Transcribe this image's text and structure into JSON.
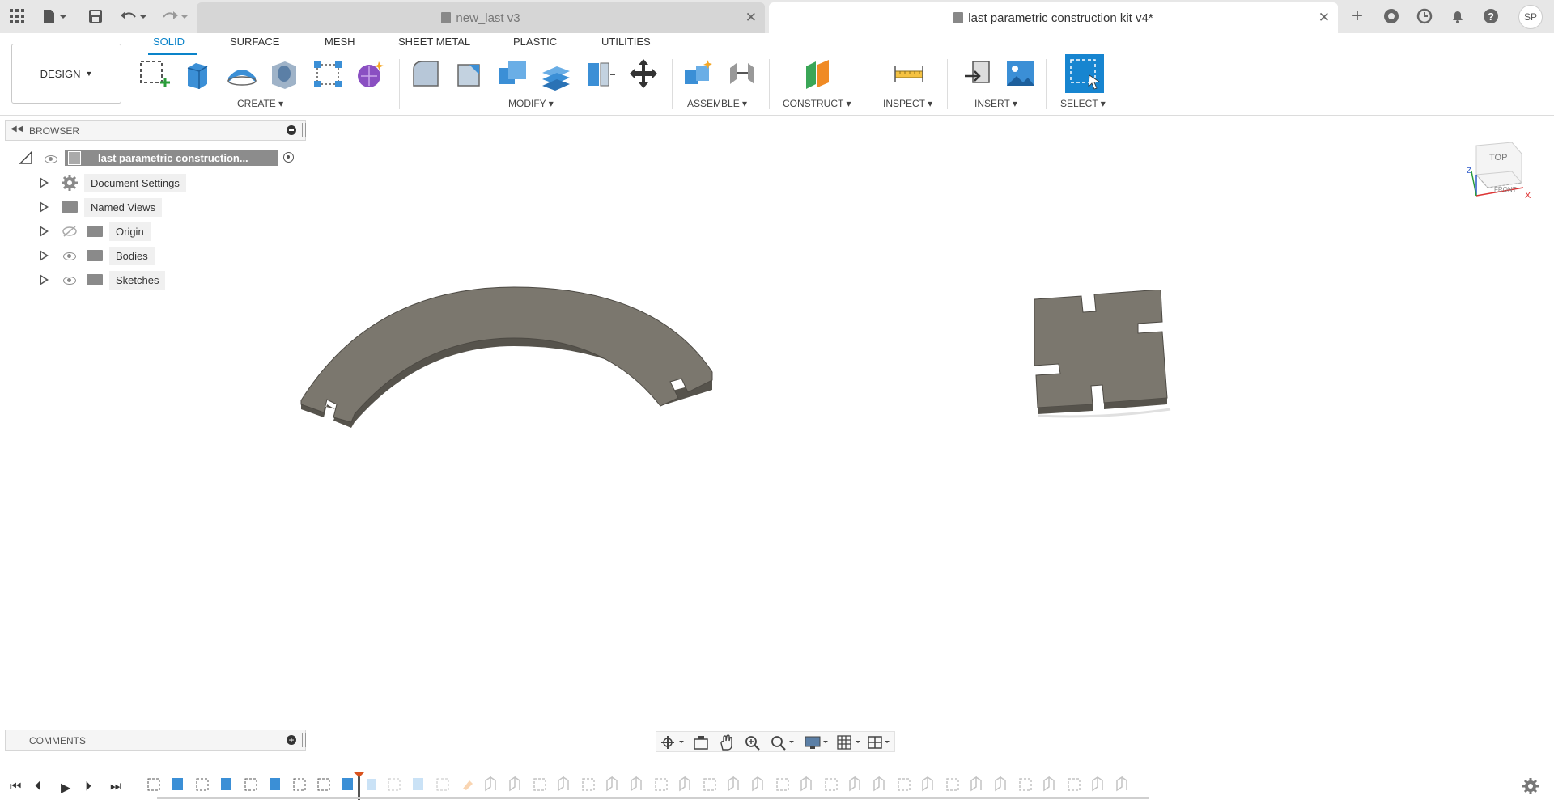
{
  "titlebar": {
    "tabs": [
      {
        "label": "new_last v3",
        "active": false
      },
      {
        "label": "last parametric construction kit v4*",
        "active": true
      }
    ],
    "user_initials": "SP"
  },
  "toolbar": {
    "workspace_label": "DESIGN",
    "top_tabs": [
      "SOLID",
      "SURFACE",
      "MESH",
      "SHEET METAL",
      "PLASTIC",
      "UTILITIES"
    ],
    "active_tab": "SOLID",
    "groups": [
      "CREATE",
      "MODIFY",
      "ASSEMBLE",
      "CONSTRUCT",
      "INSPECT",
      "INSERT",
      "SELECT"
    ],
    "accent_color": "#0a83c9"
  },
  "browser": {
    "title": "BROWSER",
    "root_label": "last parametric construction...",
    "items": [
      {
        "label": "Document Settings",
        "icon": "gear-icon"
      },
      {
        "label": "Named Views",
        "icon": "folder-icon"
      },
      {
        "label": "Origin",
        "icon": "folder-icon",
        "visibility": "hidden"
      },
      {
        "label": "Bodies",
        "icon": "folder-icon",
        "visibility": "visible"
      },
      {
        "label": "Sketches",
        "icon": "folder-icon",
        "visibility": "visible"
      }
    ]
  },
  "viewcube": {
    "top": "TOP",
    "front": "FRONT",
    "axis_x": "X",
    "axis_z": "Z"
  },
  "comments": {
    "title": "COMMENTS"
  },
  "colors": {
    "body_fill": "#7b776e",
    "body_side": "#56534c"
  }
}
